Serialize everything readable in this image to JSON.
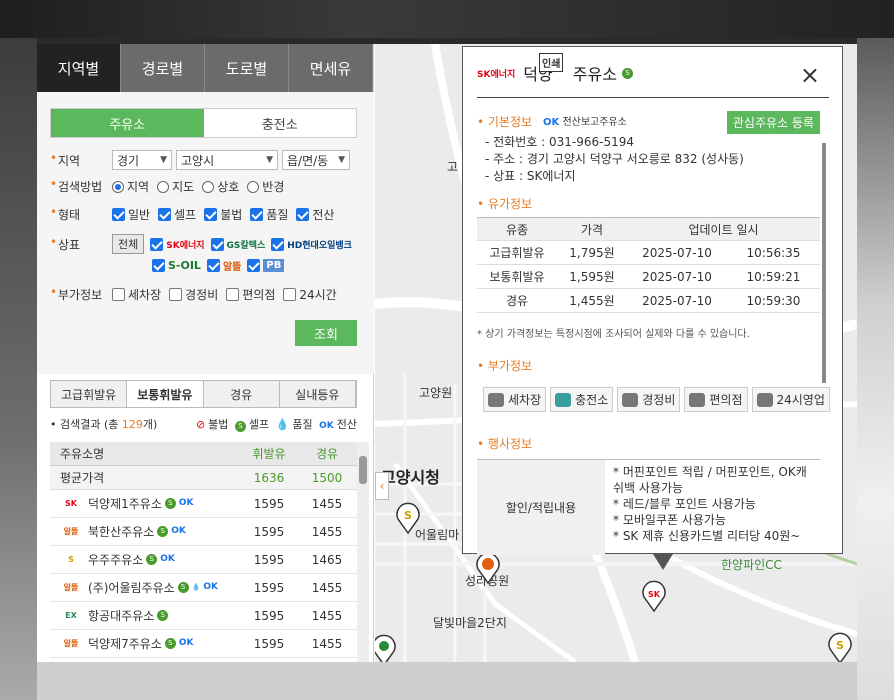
{
  "top_tabs": [
    "지역별",
    "경로별",
    "도로별",
    "면세유"
  ],
  "sub_tabs": [
    "주유소",
    "충전소"
  ],
  "form": {
    "region_label": "지역",
    "region_values": [
      "경기",
      "고양시",
      "읍/면/동"
    ],
    "method_label": "검색방법",
    "method_options": [
      "지역",
      "지도",
      "상호",
      "반경"
    ],
    "type_label": "형태",
    "type_options": [
      "일반",
      "셀프",
      "불법",
      "품질",
      "전산"
    ],
    "brand_label": "상표",
    "brand_all": "전체",
    "brand_logos": [
      "SK에너지",
      "GS칼텍스",
      "HD현대오일뱅크",
      "S-OIL",
      "알뜰",
      "PB"
    ],
    "extra_label": "부가정보",
    "extra_options": [
      "세차장",
      "경정비",
      "편의점",
      "24시간"
    ],
    "search_button": "조회"
  },
  "fuel_tabs": [
    "고급휘발유",
    "보통휘발유",
    "경유",
    "실내등유"
  ],
  "results": {
    "prefix": "검색결과 (총 ",
    "count": "129",
    "suffix": "개)",
    "legend": [
      "불법",
      "셀프",
      "품질",
      "전산"
    ]
  },
  "table": {
    "headers": [
      "주유소명",
      "휘발유",
      "경유"
    ],
    "avg": {
      "label": "평균가격",
      "gas": "1636",
      "diesel": "1500"
    },
    "rows": [
      {
        "brand": "SK",
        "name": "덕양제1주유소",
        "gas": "1595",
        "diesel": "1455"
      },
      {
        "brand": "알뜰",
        "name": "북한산주유소",
        "gas": "1595",
        "diesel": "1455"
      },
      {
        "brand": "S",
        "name": "우주주유소",
        "gas": "1595",
        "diesel": "1465"
      },
      {
        "brand": "알뜰",
        "name": "(주)어울림주유소",
        "gas": "1595",
        "diesel": "1455"
      },
      {
        "brand": "EX",
        "name": "항공대주유소",
        "gas": "1595",
        "diesel": "1455"
      },
      {
        "brand": "알뜰",
        "name": "덕양제7주유소",
        "gas": "1595",
        "diesel": "1455"
      }
    ]
  },
  "map": {
    "labels": [
      "고양시청",
      "고양원",
      "어울림마",
      "성라공원",
      "달빛마을2단지",
      "한양파인CC",
      "고"
    ]
  },
  "popup": {
    "brand_logo": "SK에너지",
    "title_pre": "덕양",
    "title_post": "주유소",
    "print_badge": "인쇄",
    "close": "×",
    "sections": {
      "basic": "기본정보",
      "price": "유가정보",
      "extra": "부가정보",
      "event": "행사정보"
    },
    "partner": "전산보고주유소",
    "fav_button": "관심주유소 등록",
    "phone": "- 전화번호 : 031-966-5194",
    "address": "- 주소 : 경기 고양시 덕양구 서오릉로 832 (성사동)",
    "brand": "- 상표 : SK에너지",
    "price_headers": [
      "유종",
      "가격",
      "업데이트 일시"
    ],
    "prices": [
      {
        "fuel": "고급휘발유",
        "price": "1,795원",
        "date": "2025-07-10",
        "time": "10:56:35"
      },
      {
        "fuel": "보통휘발유",
        "price": "1,595원",
        "date": "2025-07-10",
        "time": "10:59:21"
      },
      {
        "fuel": "경유",
        "price": "1,455원",
        "date": "2025-07-10",
        "time": "10:59:30"
      }
    ],
    "note": "* 상기 가격정보는 특정시점에 조사되어 실제와 다를 수 있습니다.",
    "services": [
      "세차장",
      "충전소",
      "경정비",
      "편의점",
      "24시영업"
    ],
    "discount_label": "할인/적립내용",
    "discounts": [
      "* 머핀포인트 적립 / 머핀포인트, OK캐쉬백 사용가능",
      "* 레드/블루 포인트 사용가능",
      "* 모바일쿠폰 사용가능",
      "* SK 제휴 신용카드별 리터당 40원~"
    ]
  }
}
